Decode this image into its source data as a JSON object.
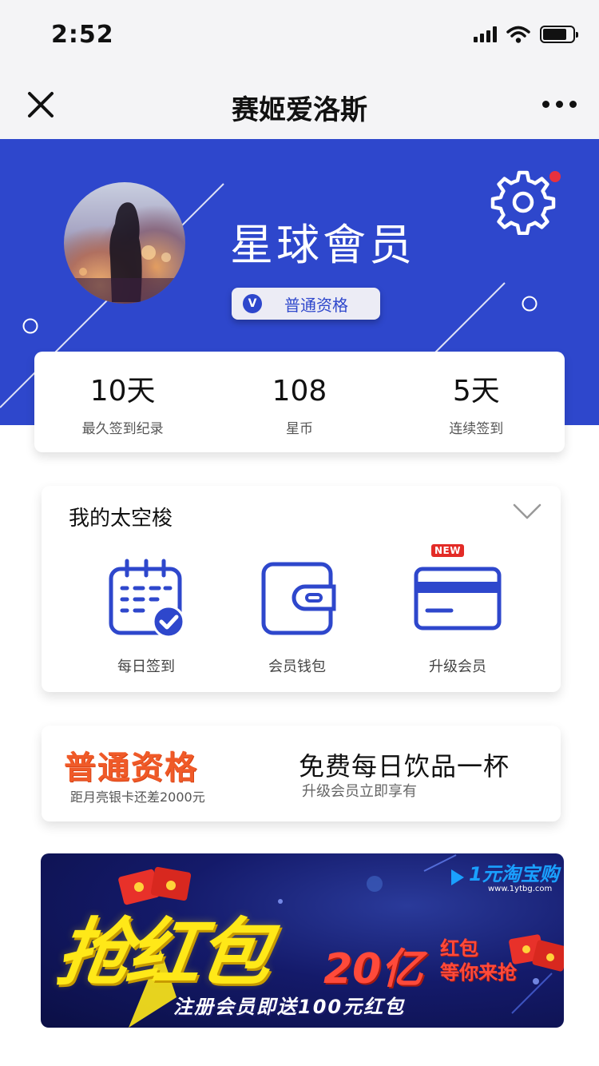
{
  "status_bar": {
    "time": "2:52"
  },
  "nav": {
    "title": "赛姬爱洛斯"
  },
  "profile": {
    "member_name": "星球會员",
    "badge_icon_text": "V",
    "badge_label": "普通资格"
  },
  "stats": [
    {
      "value": "10天",
      "label": "最久签到纪录"
    },
    {
      "value": "108",
      "label": "星币"
    },
    {
      "value": "5天",
      "label": "连续签到"
    }
  ],
  "shuttle": {
    "title": "我的太空梭",
    "items": [
      {
        "label": "每日签到",
        "icon": "calendar-check-icon"
      },
      {
        "label": "会员钱包",
        "icon": "wallet-icon"
      },
      {
        "label": "升级会员",
        "icon": "card-icon",
        "badge": "NEW"
      }
    ]
  },
  "promo": {
    "qualification": "普通资格",
    "progress_text": "距月亮银卡还差2000元",
    "title": "免费每日饮品一杯",
    "desc": "升级会员立即享有"
  },
  "banner": {
    "headline": "抢红包",
    "amount": "20亿",
    "tagline_line1": "红包",
    "tagline_line2": "等你来抢",
    "bottom_text": "注册会员即送100元红包",
    "logo_text": "1元淘宝购",
    "logo_url": "www.1ytbg.com"
  },
  "colors": {
    "brand_blue": "#2e47cc",
    "notification_red": "#e8313e",
    "promo_orange": "#f05a28",
    "new_badge_red": "#e32b26"
  }
}
